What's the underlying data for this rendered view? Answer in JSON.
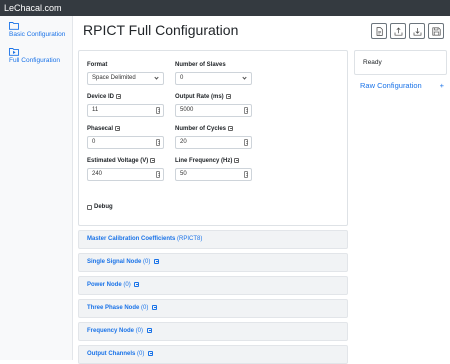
{
  "header": {
    "brand": "LeChacal.com"
  },
  "sidebar": {
    "items": [
      {
        "label": "Basic Configuration",
        "icon": "folder-icon"
      },
      {
        "label": "Full Configuration",
        "icon": "folder-play-icon"
      }
    ]
  },
  "page": {
    "title": "RPICT Full Configuration"
  },
  "toolbar": {
    "buttons": [
      {
        "icon": "document-icon"
      },
      {
        "icon": "upload-icon"
      },
      {
        "icon": "download-icon"
      },
      {
        "icon": "save-icon"
      }
    ]
  },
  "form": {
    "format": {
      "label": "Format",
      "value": "Space Delimited"
    },
    "num_slaves": {
      "label": "Number of Slaves",
      "value": "0"
    },
    "device_id": {
      "label": "Device ID",
      "value": "11"
    },
    "output_rate": {
      "label": "Output Rate (ms)",
      "value": "5000"
    },
    "phasecal": {
      "label": "Phasecal",
      "value": "0"
    },
    "num_cycles": {
      "label": "Number of Cycles",
      "value": "20"
    },
    "est_voltage": {
      "label": "Estimated Voltage (V)",
      "value": "240"
    },
    "line_freq": {
      "label": "Line Frequency (Hz)",
      "value": "50"
    },
    "debug": {
      "label": "Debug",
      "checked": false
    }
  },
  "sections": [
    {
      "title": "Master Calibration Coefficients",
      "count": "(RPICT8)",
      "help": false
    },
    {
      "title": "Single Signal Node",
      "count": "(0)",
      "help": true
    },
    {
      "title": "Power Node",
      "count": "(0)",
      "help": true
    },
    {
      "title": "Three Phase Node",
      "count": "(0)",
      "help": true
    },
    {
      "title": "Frequency Node",
      "count": "(0)",
      "help": true
    },
    {
      "title": "Output Channels",
      "count": "(0)",
      "help": true
    }
  ],
  "status": {
    "text": "Ready"
  },
  "raw_config": {
    "label": "Raw Configuration",
    "action": "+"
  },
  "colors": {
    "link": "#1a73e8",
    "topbar": "#343a40"
  }
}
